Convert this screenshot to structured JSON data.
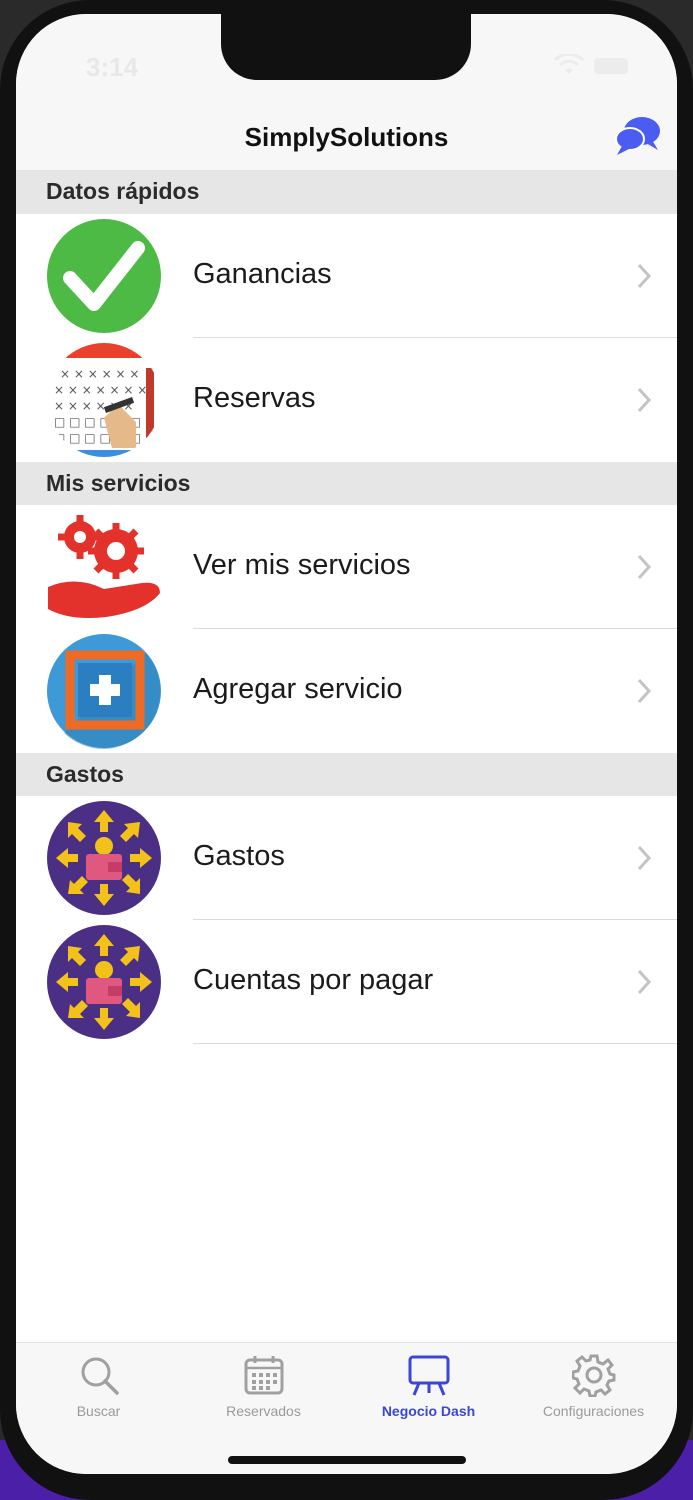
{
  "status_bar": {
    "time": "3:14"
  },
  "header": {
    "title": "SimplySolutions"
  },
  "sections": [
    {
      "title": "Datos rápidos",
      "items": [
        {
          "label": "Ganancias",
          "icon": "checkmark-icon"
        },
        {
          "label": "Reservas",
          "icon": "calendar-icon"
        }
      ]
    },
    {
      "title": "Mis servicios",
      "items": [
        {
          "label": "Ver mis servicios",
          "icon": "gears-hand-icon"
        },
        {
          "label": "Agregar servicio",
          "icon": "add-service-icon"
        }
      ]
    },
    {
      "title": "Gastos",
      "items": [
        {
          "label": "Gastos",
          "icon": "wallet-icon"
        },
        {
          "label": "Cuentas por pagar",
          "icon": "wallet-icon"
        }
      ]
    }
  ],
  "tabbar": {
    "items": [
      {
        "label": "Buscar",
        "icon": "search-icon",
        "active": false
      },
      {
        "label": "Reservados",
        "icon": "calendar-icon",
        "active": false
      },
      {
        "label": "Negocio Dash",
        "icon": "easel-icon",
        "active": true
      },
      {
        "label": "Configuraciones",
        "icon": "gear-icon",
        "active": false
      }
    ]
  },
  "colors": {
    "accent": "#3b46d6",
    "section_bg": "#e6e6e6",
    "chat_icon": "#4b5cf0"
  }
}
